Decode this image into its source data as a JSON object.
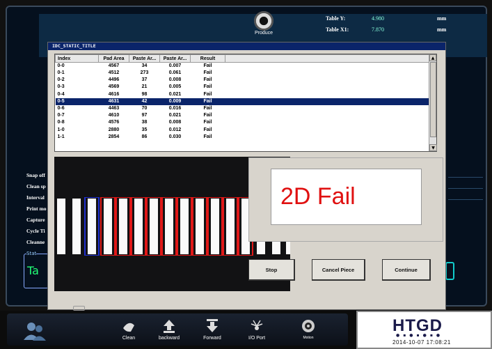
{
  "machine": {
    "gear_label": "Produce",
    "table_info": [
      {
        "label": "Table Y:",
        "value": "4.980",
        "unit": "mm"
      },
      {
        "label": "Table X1:",
        "value": "7.870",
        "unit": "mm"
      }
    ],
    "left_labels": [
      "Snap off",
      "Clean sp",
      "Interval",
      "Print mo",
      "Capture",
      "Cycle Ti",
      "Cleanne"
    ],
    "status_title": "Stat",
    "status_value": "Ta"
  },
  "dialog": {
    "title": "IDC_STATIC_TITLE",
    "columns": [
      "Index",
      "Pad Area",
      "Paste Ar...",
      "Paste Ar...",
      "Result"
    ],
    "rows": [
      [
        "0-0",
        "4567",
        "34",
        "0.007",
        "Fail"
      ],
      [
        "0-1",
        "4512",
        "273",
        "0.061",
        "Fail"
      ],
      [
        "0-2",
        "4496",
        "37",
        "0.008",
        "Fail"
      ],
      [
        "0-3",
        "4569",
        "21",
        "0.005",
        "Fail"
      ],
      [
        "0-4",
        "4616",
        "98",
        "0.021",
        "Fail"
      ],
      [
        "0-5",
        "4631",
        "42",
        "0.009",
        "Fail"
      ],
      [
        "0-6",
        "4463",
        "70",
        "0.016",
        "Fail"
      ],
      [
        "0-7",
        "4610",
        "97",
        "0.021",
        "Fail"
      ],
      [
        "0-8",
        "4576",
        "38",
        "0.008",
        "Fail"
      ],
      [
        "1-0",
        "2880",
        "35",
        "0.012",
        "Fail"
      ],
      [
        "1-1",
        "2854",
        "86",
        "0.030",
        "Fail"
      ]
    ],
    "selected_row": 5,
    "result_text": "2D Fail",
    "buttons": {
      "stop": "Stop",
      "cancel_piece": "Cancel Piece",
      "continue": "Continue"
    }
  },
  "taskbar": {
    "buttons": [
      {
        "label": "Clean",
        "icon": "clean-icon"
      },
      {
        "label": "backward",
        "icon": "backward-arrow-icon"
      },
      {
        "label": "Forward",
        "icon": "forward-arrow-icon"
      },
      {
        "label": "I/O Port",
        "icon": "io-port-icon"
      },
      {
        "label": "Motion",
        "icon": "motion-gear-icon"
      }
    ],
    "logo": "HTGD",
    "datetime": "2014-10-07   17:08:21"
  },
  "colors": {
    "fail_red": "#e01010",
    "selection": "#0a246a",
    "title_bar": "#0a246a"
  }
}
